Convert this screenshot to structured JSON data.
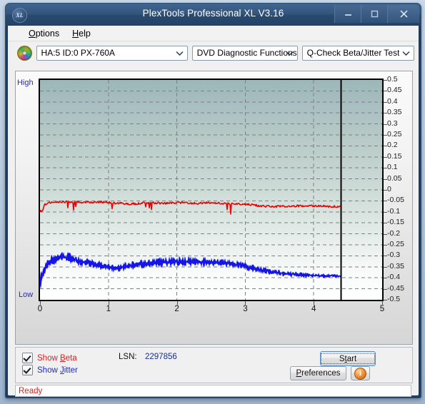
{
  "window": {
    "title": "PlexTools Professional XL V3.16",
    "logo_text": "XL",
    "minimize_label": "Minimize",
    "maximize_label": "Maximize",
    "close_label": "Close"
  },
  "menubar": {
    "items": [
      {
        "label": "Options",
        "accel": "O"
      },
      {
        "label": "Help",
        "accel": "H"
      }
    ]
  },
  "toolbar": {
    "drive_combo": "HA:5 ID:0  PX-760A",
    "function_combo": "DVD Diagnostic Functions",
    "test_combo": "Q-Check Beta/Jitter Test",
    "disc_icon": "disc-icon"
  },
  "chart_labels": {
    "high": "High",
    "low": "Low"
  },
  "options": {
    "show_beta": "Show Beta",
    "show_jitter": "Show Jitter",
    "show_beta_checked": true,
    "show_jitter_checked": true,
    "lsn_label": "LSN:",
    "lsn_value": "2297856",
    "start_button": "Start",
    "preferences_button": "Preferences",
    "info_button": "i"
  },
  "status": {
    "text": "Ready"
  },
  "colors": {
    "beta": "#ee0000",
    "jitter": "#1515e8",
    "marker_line": "#000000",
    "grid": "#808080",
    "axis_text": "#111111",
    "label_text": "#2626d6",
    "status_text": "#e21b1b",
    "titlebar": "#2f5179"
  },
  "chart_data": {
    "type": "line",
    "title": "Q-Check Beta/Jitter Test",
    "xlabel": "",
    "ylabel": "",
    "xlim": [
      0,
      5
    ],
    "ylim": [
      -0.5,
      0.5
    ],
    "grid": true,
    "legend_position": "bottom-left",
    "xticks": [
      0,
      1,
      2,
      3,
      4,
      5
    ],
    "yticks": [
      0.5,
      0.45,
      0.4,
      0.35,
      0.3,
      0.25,
      0.2,
      0.15,
      0.1,
      0.05,
      0,
      -0.05,
      -0.1,
      -0.15,
      -0.2,
      -0.25,
      -0.3,
      -0.35,
      -0.4,
      -0.45,
      -0.5
    ],
    "ytick_labels": [
      "0.5",
      "0.45",
      "0.4",
      "0.35",
      "0.3",
      "0.25",
      "0.2",
      "0.15",
      "0.1",
      "0.05",
      "0",
      "-0.05",
      "-0.1",
      "-0.15",
      "-0.2",
      "-0.25",
      "-0.3",
      "-0.35",
      "-0.4",
      "-0.45",
      "-0.5"
    ],
    "data_end_x": 4.4,
    "marker_line_x": 4.4,
    "series": [
      {
        "name": "Beta",
        "color": "#ee0000",
        "x": [
          0.0,
          0.03,
          0.06,
          0.1,
          0.15,
          0.2,
          0.3,
          0.4,
          0.5,
          0.6,
          0.7,
          0.8,
          0.9,
          1.0,
          1.1,
          1.2,
          1.3,
          1.4,
          1.5,
          1.6,
          1.7,
          1.8,
          1.9,
          2.0,
          2.1,
          2.2,
          2.3,
          2.4,
          2.5,
          2.6,
          2.7,
          2.8,
          2.9,
          3.0,
          3.1,
          3.2,
          3.3,
          3.4,
          3.5,
          3.6,
          3.7,
          3.8,
          3.9,
          4.0,
          4.1,
          4.2,
          4.3,
          4.4
        ],
        "values": [
          -0.095,
          -0.1,
          -0.07,
          -0.062,
          -0.058,
          -0.056,
          -0.055,
          -0.055,
          -0.056,
          -0.055,
          -0.056,
          -0.057,
          -0.056,
          -0.057,
          -0.06,
          -0.062,
          -0.065,
          -0.063,
          -0.06,
          -0.058,
          -0.06,
          -0.062,
          -0.06,
          -0.059,
          -0.058,
          -0.06,
          -0.062,
          -0.06,
          -0.058,
          -0.06,
          -0.062,
          -0.063,
          -0.064,
          -0.065,
          -0.068,
          -0.072,
          -0.075,
          -0.076,
          -0.075,
          -0.074,
          -0.073,
          -0.074,
          -0.072,
          -0.073,
          -0.074,
          -0.075,
          -0.076,
          -0.077
        ]
      },
      {
        "name": "Jitter",
        "color": "#1515e8",
        "x": [
          0.0,
          0.03,
          0.06,
          0.1,
          0.15,
          0.2,
          0.3,
          0.4,
          0.5,
          0.6,
          0.7,
          0.8,
          0.9,
          1.0,
          1.1,
          1.2,
          1.3,
          1.4,
          1.5,
          1.6,
          1.7,
          1.8,
          1.9,
          2.0,
          2.1,
          2.2,
          2.3,
          2.4,
          2.5,
          2.6,
          2.7,
          2.8,
          2.9,
          3.0,
          3.1,
          3.2,
          3.3,
          3.4,
          3.5,
          3.6,
          3.7,
          3.8,
          3.9,
          4.0,
          4.1,
          4.2,
          4.3,
          4.4
        ],
        "values": [
          -0.42,
          -0.4,
          -0.37,
          -0.345,
          -0.325,
          -0.315,
          -0.305,
          -0.31,
          -0.318,
          -0.325,
          -0.33,
          -0.338,
          -0.345,
          -0.352,
          -0.356,
          -0.352,
          -0.345,
          -0.34,
          -0.338,
          -0.336,
          -0.332,
          -0.33,
          -0.328,
          -0.326,
          -0.325,
          -0.326,
          -0.327,
          -0.328,
          -0.328,
          -0.33,
          -0.332,
          -0.336,
          -0.342,
          -0.348,
          -0.356,
          -0.362,
          -0.368,
          -0.374,
          -0.378,
          -0.382,
          -0.384,
          -0.386,
          -0.388,
          -0.39,
          -0.39,
          -0.391,
          -0.392,
          -0.393
        ],
        "band": [
          0.055,
          0.05,
          0.045,
          0.042,
          0.04,
          0.04,
          0.041,
          0.04,
          0.038,
          0.036,
          0.034,
          0.032,
          0.03,
          0.028,
          0.026,
          0.028,
          0.03,
          0.031,
          0.032,
          0.033,
          0.034,
          0.035,
          0.034,
          0.034,
          0.033,
          0.033,
          0.032,
          0.032,
          0.031,
          0.03,
          0.029,
          0.028,
          0.027,
          0.026,
          0.025,
          0.024,
          0.023,
          0.021,
          0.02,
          0.019,
          0.018,
          0.017,
          0.016,
          0.015,
          0.014,
          0.014,
          0.013,
          0.013
        ]
      }
    ]
  }
}
